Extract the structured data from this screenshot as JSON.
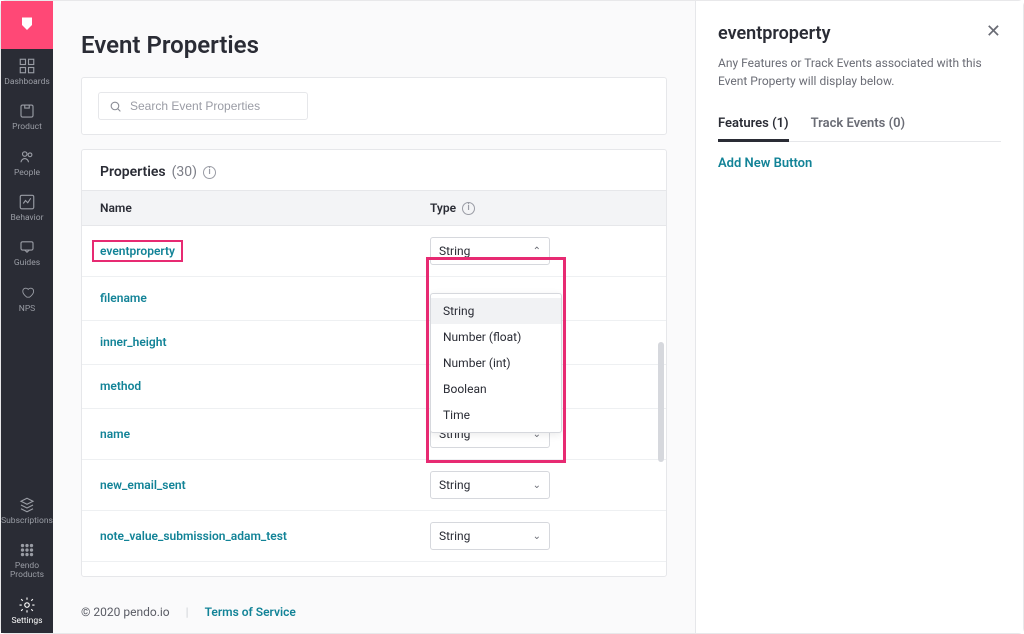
{
  "sidebar": {
    "items": [
      {
        "label": "Dashboards"
      },
      {
        "label": "Product"
      },
      {
        "label": "People"
      },
      {
        "label": "Behavior"
      },
      {
        "label": "Guides"
      },
      {
        "label": "NPS"
      }
    ],
    "bottom": [
      {
        "label": "Subscriptions"
      },
      {
        "label": "Pendo Products"
      },
      {
        "label": "Settings"
      }
    ]
  },
  "page": {
    "title": "Event Properties",
    "search_placeholder": "Search Event Properties"
  },
  "properties": {
    "header_label": "Properties",
    "count_label": "(30)",
    "col_name": "Name",
    "col_type": "Type",
    "rows": [
      {
        "name": "eventproperty",
        "type": "String",
        "highlighted": true,
        "open": true
      },
      {
        "name": "filename",
        "type": ""
      },
      {
        "name": "inner_height",
        "type": ""
      },
      {
        "name": "method",
        "type": ""
      },
      {
        "name": "name",
        "type": "String"
      },
      {
        "name": "new_email_sent",
        "type": "String"
      },
      {
        "name": "note_value_submission_adam_test",
        "type": "String"
      }
    ],
    "dropdown_options": [
      "String",
      "Number (float)",
      "Number (int)",
      "Boolean",
      "Time"
    ]
  },
  "footer": {
    "copyright": "© 2020 pendo.io",
    "tos": "Terms of Service"
  },
  "detail": {
    "title": "eventproperty",
    "description": "Any Features or Track Events associated with this Event Property will display below.",
    "tabs": [
      {
        "label": "Features (1)",
        "active": true
      },
      {
        "label": "Track Events (0)",
        "active": false
      }
    ],
    "add_button": "Add New Button"
  }
}
